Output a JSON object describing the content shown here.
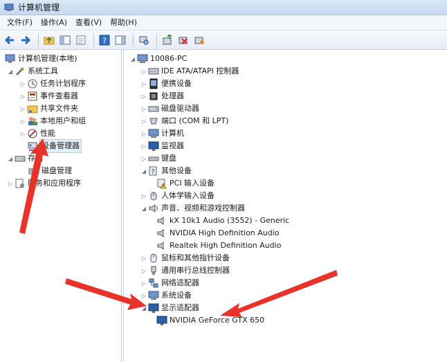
{
  "window": {
    "title": "计算机管理"
  },
  "menu": [
    "文件(F)",
    "操作(A)",
    "查看(V)",
    "帮助(H)"
  ],
  "toolbar": [
    "back-icon",
    "forward-icon",
    "up-folder-icon",
    "show-hide-tree-icon",
    "export-icon",
    "help-icon",
    "properties-icon",
    "scan-hardware-icon",
    "update-driver-icon",
    "disable-device-icon",
    "uninstall-device-icon"
  ],
  "left_tree": {
    "root": "计算机管理(本地)",
    "system_tools": "系统工具",
    "task_scheduler": "任务计划程序",
    "event_viewer": "事件查看器",
    "shared_folders": "共享文件夹",
    "local_users": "本地用户和组",
    "performance": "性能",
    "device_manager": "设备管理器",
    "storage": "存储",
    "disk_management": "磁盘管理",
    "services_apps": "服务和应用程序"
  },
  "device_tree": {
    "root": "10086-PC",
    "categories": [
      "IDE ATA/ATAPI 控制器",
      "便携设备",
      "处理器",
      "磁盘驱动器",
      "端口 (COM 和 LPT)",
      "计算机",
      "监视器",
      "键盘",
      "其他设备",
      "PCI 输入设备",
      "人体学输入设备",
      "声音、视频和游戏控制器",
      "kX 10k1 Audio (3552) - Generic",
      "NVIDIA High Definition Audio",
      "Realtek High Definition Audio",
      "鼠标和其他指针设备",
      "通用串行总线控制器",
      "网络适配器",
      "系统设备",
      "显示适配器",
      "NVIDIA GeForce GTX 650"
    ]
  },
  "colors": {
    "annotation_arrow": "#e8332a",
    "selection": "#e5eef9"
  }
}
